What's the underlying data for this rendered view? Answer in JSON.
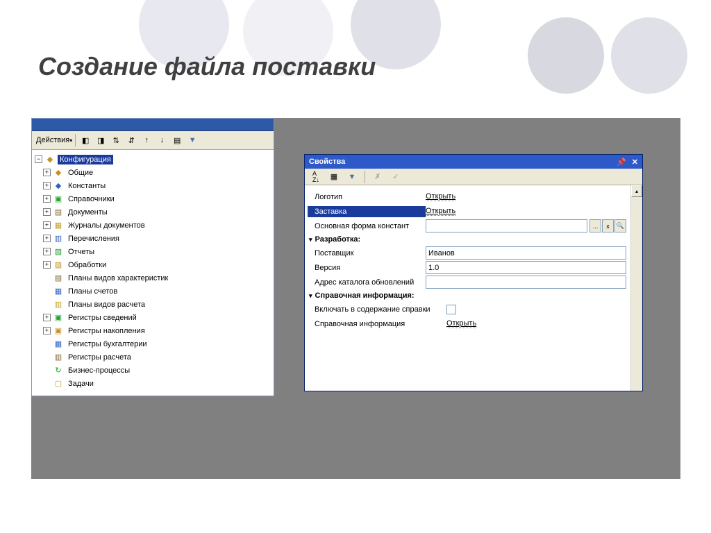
{
  "slide": {
    "title": "Создание файла поставки"
  },
  "leftPanel": {
    "actions": "Действия",
    "root": "Конфигурация",
    "items": [
      {
        "label": "Общие",
        "expandable": true
      },
      {
        "label": "Константы",
        "expandable": true
      },
      {
        "label": "Справочники",
        "expandable": true
      },
      {
        "label": "Документы",
        "expandable": true
      },
      {
        "label": "Журналы документов",
        "expandable": true
      },
      {
        "label": "Перечисления",
        "expandable": true
      },
      {
        "label": "Отчеты",
        "expandable": true
      },
      {
        "label": "Обработки",
        "expandable": true
      },
      {
        "label": "Планы видов характеристик",
        "expandable": false
      },
      {
        "label": "Планы счетов",
        "expandable": false
      },
      {
        "label": "Планы видов расчета",
        "expandable": false
      },
      {
        "label": "Регистры сведений",
        "expandable": true
      },
      {
        "label": "Регистры накопления",
        "expandable": true
      },
      {
        "label": "Регистры бухгалтерии",
        "expandable": false
      },
      {
        "label": "Регистры расчета",
        "expandable": false
      },
      {
        "label": "Бизнес-процессы",
        "expandable": false
      },
      {
        "label": "Задачи",
        "expandable": false
      }
    ]
  },
  "props": {
    "title": "Свойства",
    "rows": {
      "logo_label": "Логотип",
      "logo_value": "Открыть",
      "splash_label": "Заставка",
      "splash_value": "Открыть",
      "const_form_label": "Основная форма констант",
      "const_form_value": ""
    },
    "section_dev": "Разработка:",
    "dev": {
      "vendor_label": "Поставщик",
      "vendor_value": "Иванов",
      "version_label": "Версия",
      "version_value": "1.0",
      "update_label": "Адрес каталога обновлений",
      "update_value": ""
    },
    "section_help": "Справочная информация:",
    "help": {
      "include_label": "Включать в содержание справки",
      "info_label": "Справочная информация",
      "info_value": "Открыть"
    },
    "btn_dots": "...",
    "btn_x": "x"
  }
}
